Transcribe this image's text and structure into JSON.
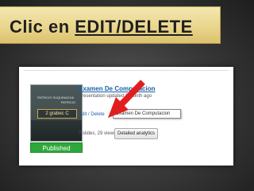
{
  "slide": {
    "title_prefix": "Clic en ",
    "title_emphasis": "EDIT/DELETE"
  },
  "thumbnail": {
    "line1": "PATRICIO SUQUINAGUA",
    "line2": "PATRICIO",
    "box_text": "2 grabec C",
    "status": "Published"
  },
  "presentation": {
    "title": "Examen De Computacion",
    "subtitle": "Presentation updated 1 month ago",
    "edit_link": "Edit / Delete",
    "tooltip": "Examen De Computacion",
    "stats": "7 slides, 29 views",
    "analytics_button": "Detailed analytics"
  },
  "colors": {
    "banner": "#e9d48a",
    "link": "#1a5fa8",
    "published": "#2ea83a",
    "arrow": "#e01e1e"
  },
  "icons": {
    "pointer": "red-arrow-icon"
  }
}
